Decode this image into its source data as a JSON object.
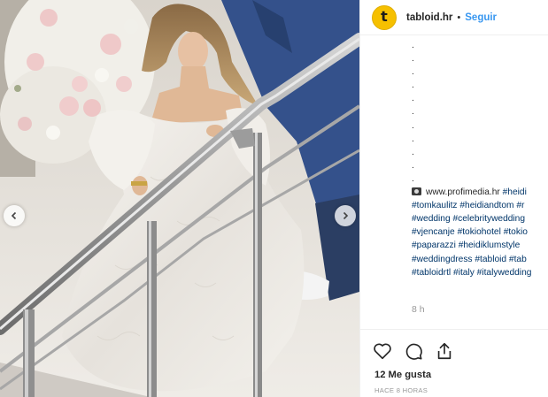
{
  "post": {
    "username": "tabloid.hr",
    "separator": "•",
    "follow_label": "Seguir",
    "avatar_letter": "t"
  },
  "caption": {
    "dots": [
      ".",
      ".",
      ".",
      ".",
      ".",
      ".",
      ".",
      ".",
      ".",
      ".",
      "."
    ],
    "credit_text": "www.profimedia.hr",
    "lines": [
      [
        "#heidi"
      ],
      [
        "#tomkaulitz",
        "#heidiandtom",
        "#r"
      ],
      [
        "#wedding",
        "#celebritywedding"
      ],
      [
        "#vjencanje",
        "#tokiohotel",
        "#tokio"
      ],
      [
        "#paparazzi",
        "#heidiklumstyle"
      ],
      [
        "#weddingdress",
        "#tabloid",
        "#tab"
      ],
      [
        "#tabloidrtl",
        "#italy",
        "#italywedding"
      ]
    ],
    "time": "8 h"
  },
  "stats": {
    "likes": "12 Me gusta",
    "ago": "HACE 8 HORAS"
  },
  "icons": {
    "like": "heart-icon",
    "comment": "comment-icon",
    "share": "share-icon",
    "prev": "chevron-left-icon",
    "next": "chevron-right-icon",
    "credit": "camera-icon"
  },
  "colors": {
    "link": "#003569",
    "follow": "#3897f0",
    "avatar_bg": "#f6c000",
    "muted": "#999999"
  }
}
